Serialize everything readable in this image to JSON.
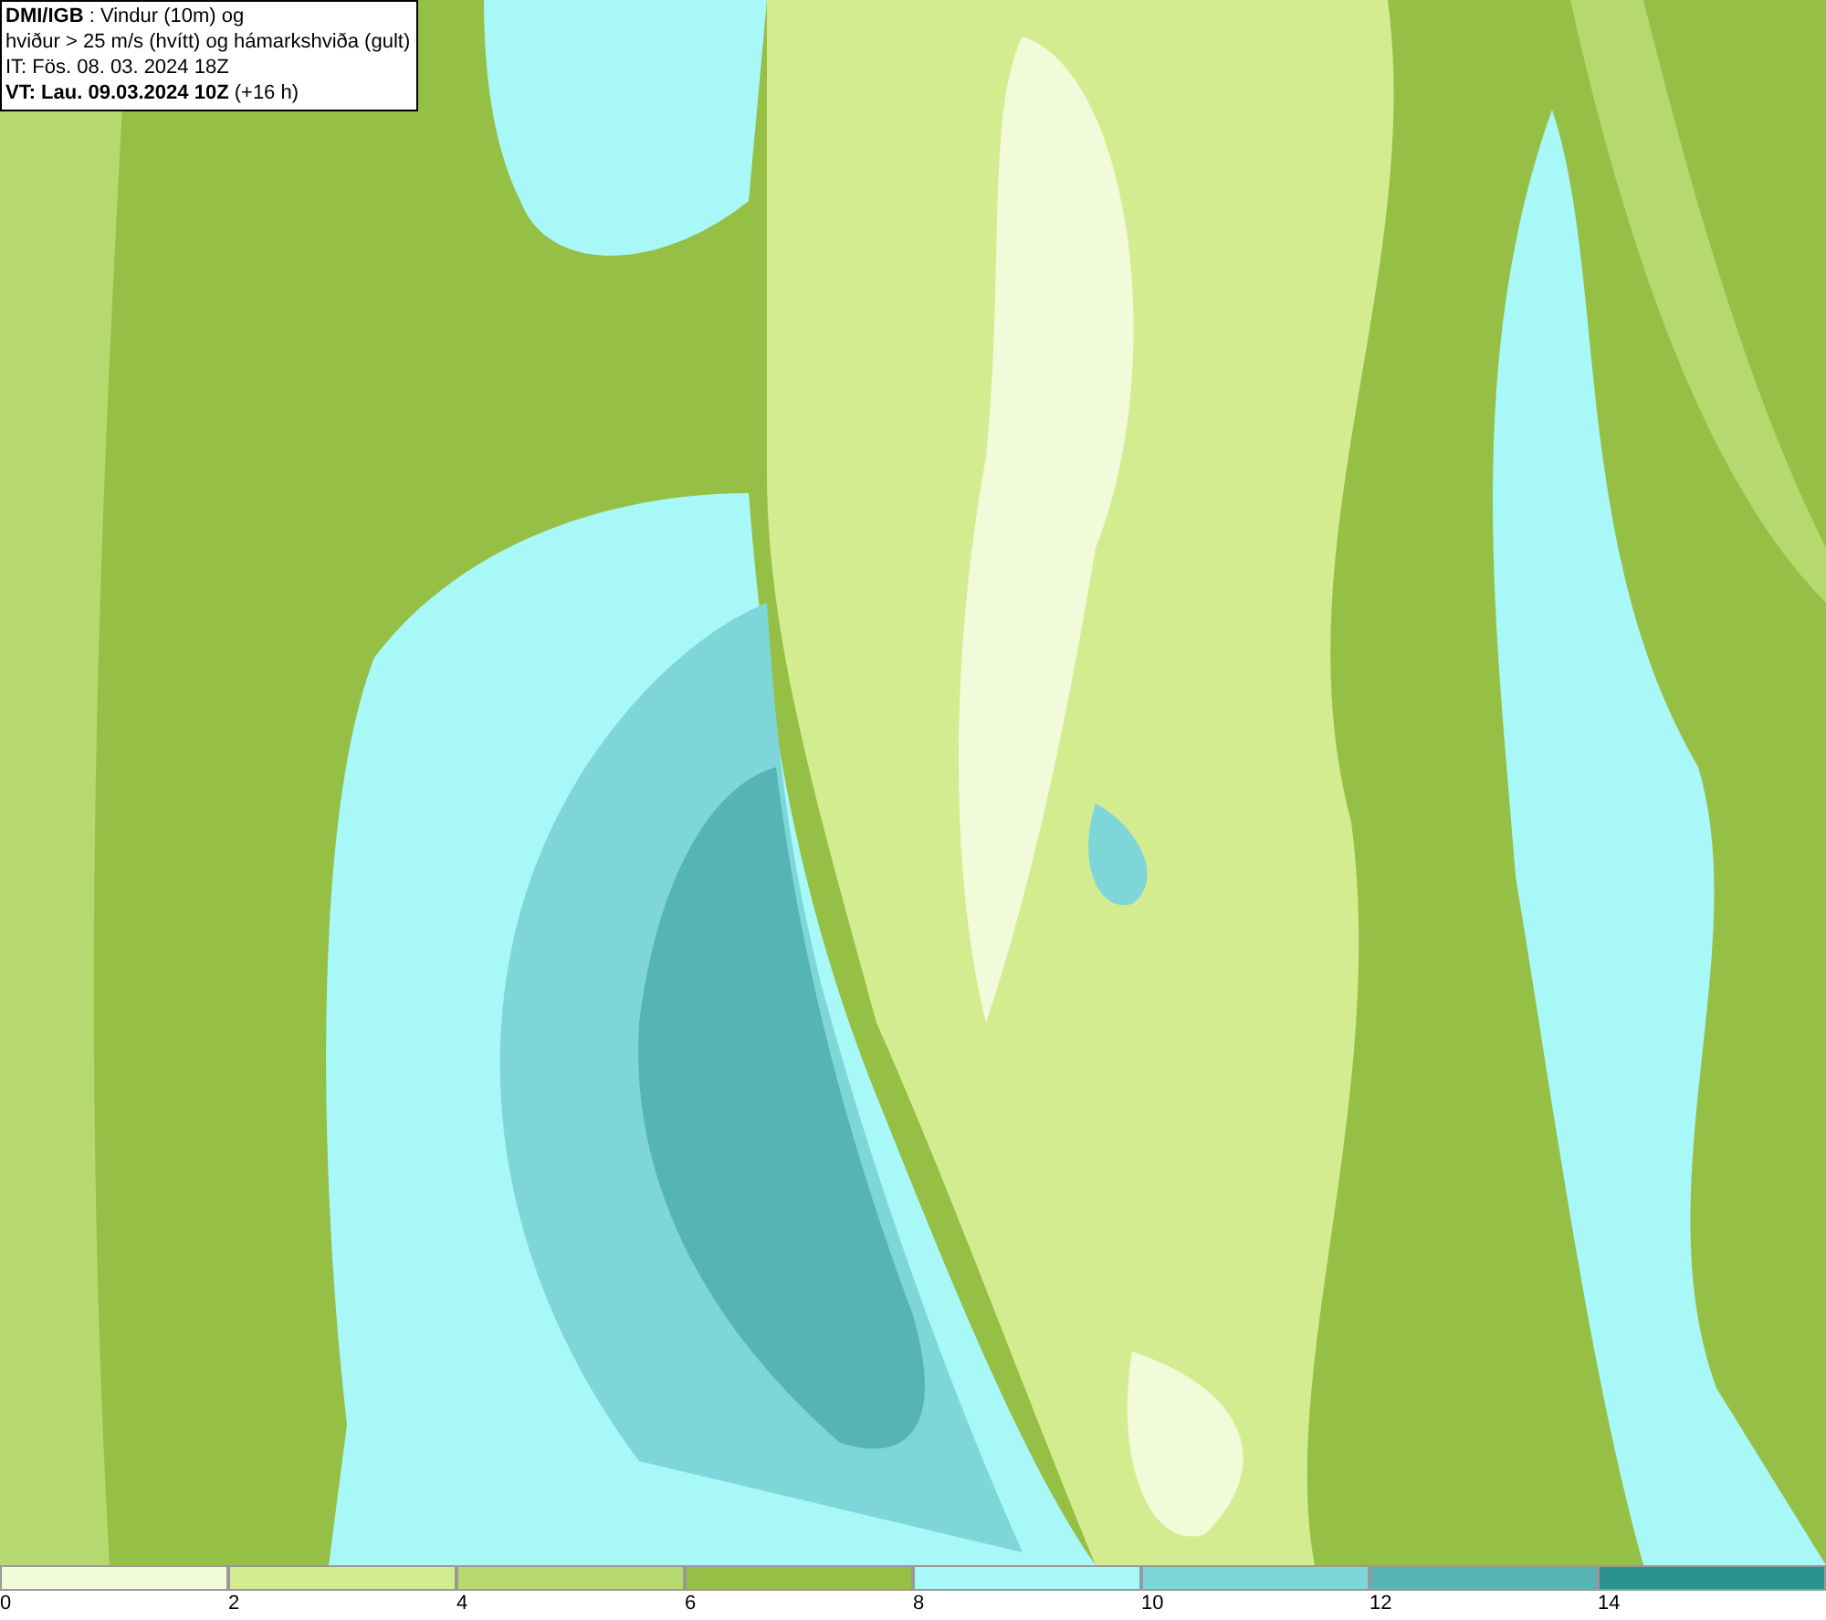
{
  "info_box": {
    "lines": [
      "**DMI/IGB** : Vindur (10m) og",
      "hviður > 25 m/s (hvítt) og hámarkshviða (gult)",
      "IT: Fös. 08. 03. 2024 18Z",
      "**VT: Lau. 09.03.2024 10Z** (+16 h)"
    ]
  },
  "legend": [
    {
      "label": "0",
      "color": "#f2fbd9"
    },
    {
      "label": "2",
      "color": "#d3ec8f"
    },
    {
      "label": "4",
      "color": "#b5d96e"
    },
    {
      "label": "6",
      "color": "#95bf45"
    },
    {
      "label": "8",
      "color": "#a8f8f8"
    },
    {
      "label": "10",
      "color": "#7fd6d8"
    },
    {
      "label": "12",
      "color": "#56b4b5"
    },
    {
      "label": "14",
      "color": "#2a928e"
    }
  ]
}
